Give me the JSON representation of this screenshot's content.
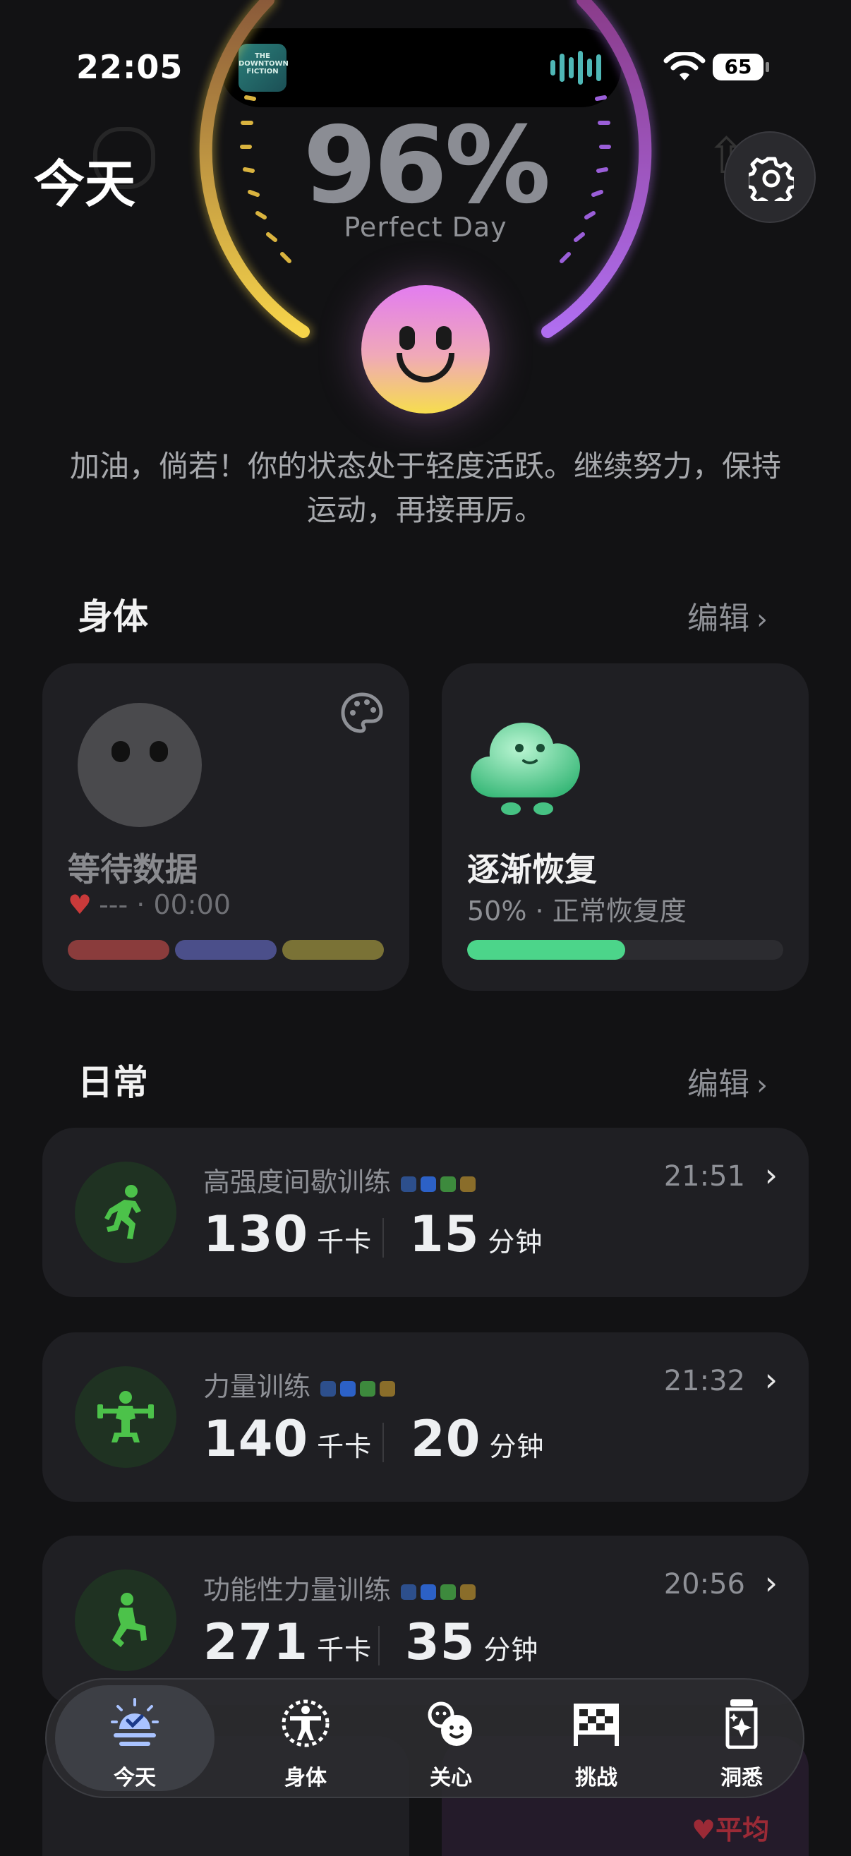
{
  "status": {
    "time": "22:05",
    "battery": "65",
    "island_art": "THE DOWNTOWN FICTION"
  },
  "header": {
    "title": "今天",
    "score": "96%",
    "score_label": "Perfect Day"
  },
  "message": "加油，倘若！你的状态处于轻度活跃。继续努力，保持运动，再接再厉。",
  "body_section": {
    "title": "身体",
    "edit": "编辑",
    "cards": [
      {
        "title": "等待数据",
        "subtitle": "--- · 00:00",
        "segment_colors": [
          "#8a3c3c",
          "#4b4f8a",
          "#7a7236"
        ]
      },
      {
        "title": "逐渐恢复",
        "subtitle": "50% · 正常恢复度",
        "progress": 0.5,
        "progress_color": "#4cd58a"
      }
    ]
  },
  "daily_section": {
    "title": "日常",
    "edit": "编辑",
    "activities": [
      {
        "name": "高强度间歇训练",
        "time": "21:51",
        "kcal": "130",
        "kcal_unit": "千卡",
        "minutes": "15",
        "minutes_unit": "分钟",
        "icon": "running-icon"
      },
      {
        "name": "力量训练",
        "time": "21:32",
        "kcal": "140",
        "kcal_unit": "千卡",
        "minutes": "20",
        "minutes_unit": "分钟",
        "icon": "weightlifting-icon"
      },
      {
        "name": "功能性力量训练",
        "time": "20:56",
        "kcal": "271",
        "kcal_unit": "千卡",
        "minutes": "35",
        "minutes_unit": "分钟",
        "icon": "lunge-icon"
      }
    ],
    "intensity_colors": [
      "#2d4f8c",
      "#2c61c7",
      "#3d8a3d",
      "#8a6d2a"
    ]
  },
  "peek": {
    "right_label": "平均"
  },
  "tabs": [
    {
      "label": "今天",
      "icon": "sunrise-check-icon",
      "active": true
    },
    {
      "label": "身体",
      "icon": "body-figure-icon"
    },
    {
      "label": "关心",
      "icon": "care-faces-icon"
    },
    {
      "label": "挑战",
      "icon": "checkered-flag-icon"
    },
    {
      "label": "洞悉",
      "icon": "sparkle-jar-icon"
    }
  ],
  "colors": {
    "accent_green": "#4cd58a",
    "activity_green": "#4cc24a",
    "gauge_yellow": "#f6d44a",
    "gauge_purple": "#b06ef0"
  }
}
